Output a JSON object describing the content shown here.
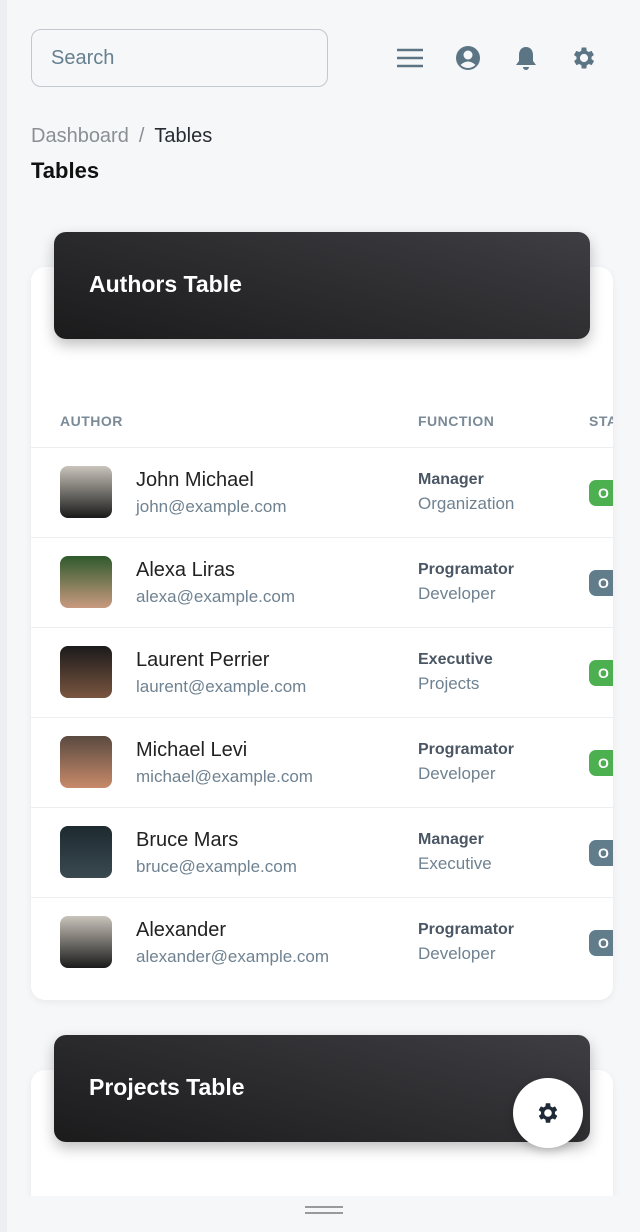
{
  "search": {
    "placeholder": "Search"
  },
  "navbar": {
    "icons": [
      "menu-icon",
      "account-icon",
      "notifications-icon",
      "settings-icon"
    ],
    "icon_color": "#5c7585"
  },
  "breadcrumb": {
    "parent": "Dashboard",
    "separator": "/",
    "current": "Tables"
  },
  "page_title": "Tables",
  "authors_table": {
    "title": "Authors Table",
    "columns": [
      "AUTHOR",
      "FUNCTION",
      "STA"
    ],
    "rows": [
      {
        "name": "John Michael",
        "email": "john@example.com",
        "function": "Manager",
        "department": "Organization",
        "status": "O",
        "status_color": "#4caf50"
      },
      {
        "name": "Alexa Liras",
        "email": "alexa@example.com",
        "function": "Programator",
        "department": "Developer",
        "status": "O",
        "status_color": "#617d8b"
      },
      {
        "name": "Laurent Perrier",
        "email": "laurent@example.com",
        "function": "Executive",
        "department": "Projects",
        "status": "O",
        "status_color": "#4caf50"
      },
      {
        "name": "Michael Levi",
        "email": "michael@example.com",
        "function": "Programator",
        "department": "Developer",
        "status": "O",
        "status_color": "#4caf50"
      },
      {
        "name": "Bruce Mars",
        "email": "bruce@example.com",
        "function": "Manager",
        "department": "Executive",
        "status": "O",
        "status_color": "#617d8b"
      },
      {
        "name": "Alexander",
        "email": "alexander@example.com",
        "function": "Programator",
        "department": "Developer",
        "status": "O",
        "status_color": "#617d8b"
      }
    ]
  },
  "projects_table": {
    "title": "Projects Table"
  },
  "fab": {
    "icon": "settings-icon"
  }
}
